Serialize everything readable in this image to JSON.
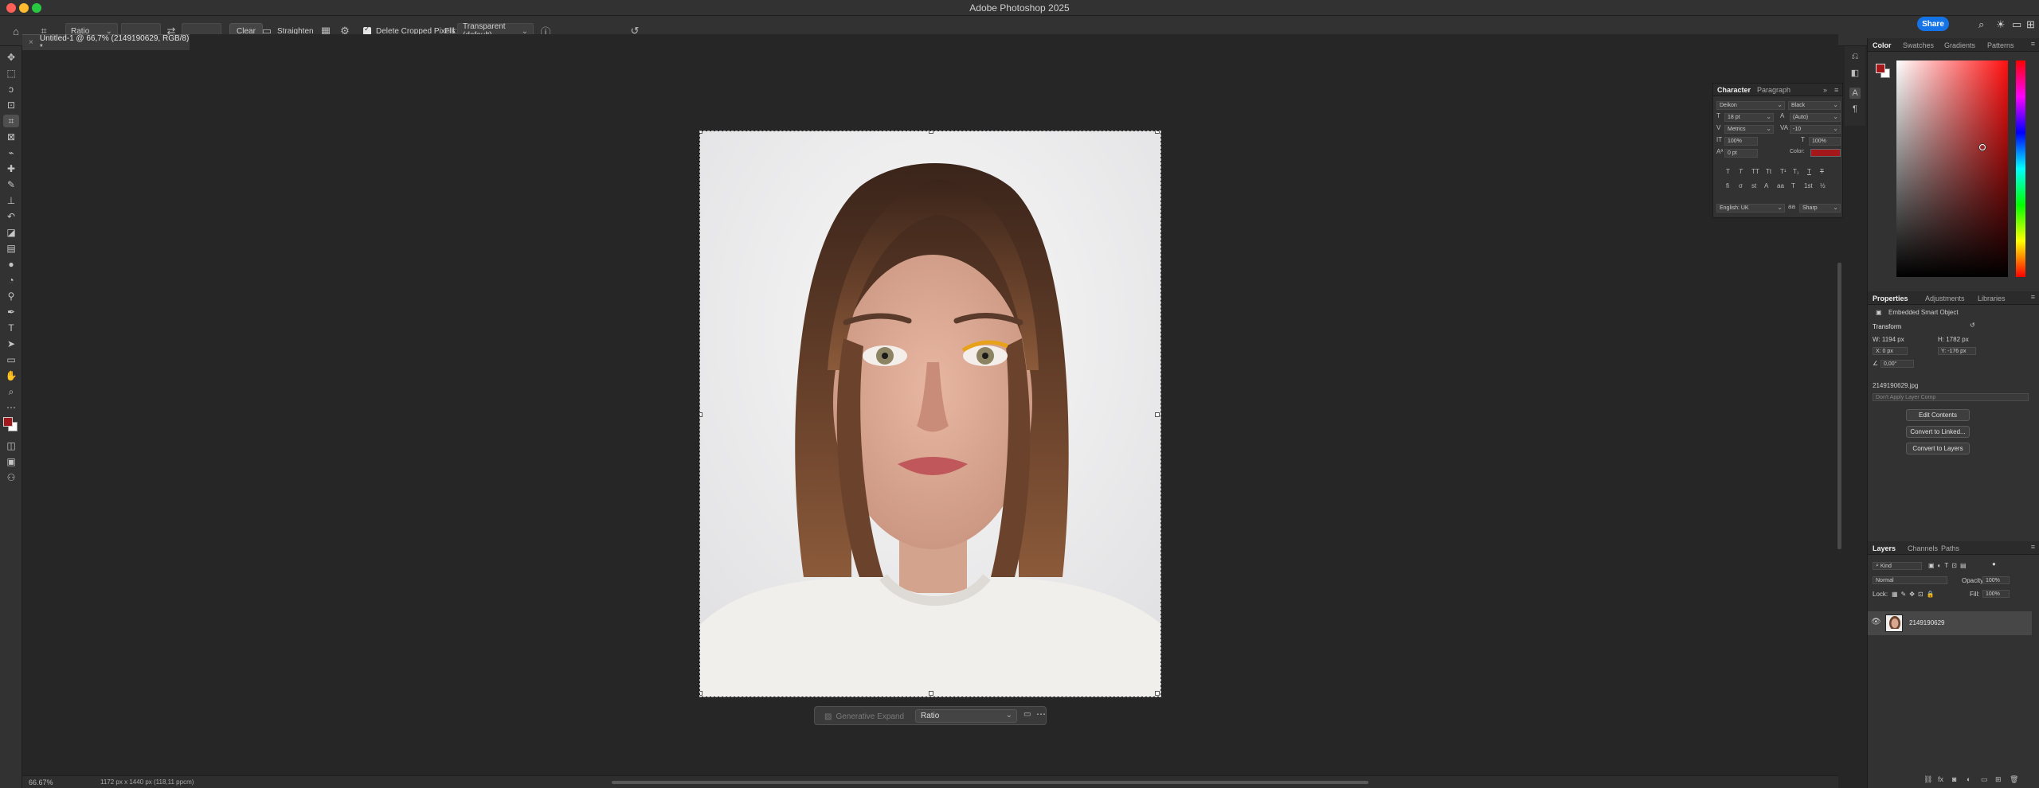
{
  "app": {
    "title": "Adobe Photoshop 2025",
    "share_label": "Share"
  },
  "options_bar": {
    "ratio_label": "Ratio",
    "clear_label": "Clear",
    "straighten_label": "Straighten",
    "delete_cropped_label": "Delete Cropped Pixels",
    "fill_label": "Fill:",
    "fill_value": "Transparent (default)"
  },
  "document": {
    "tab_title": "Untitled-1 @ 66,7% (2149190629, RGB/8) *"
  },
  "generative_bar": {
    "expand_label": "Generative Expand",
    "ratio_value": "Ratio"
  },
  "status": {
    "zoom": "66.67%",
    "doc_info": "1172 px x 1440 px (118,11 ppcm)"
  },
  "character": {
    "tabs": [
      "Character",
      "Paragraph"
    ],
    "font_family": "Deikon",
    "font_style": "Black",
    "font_size": "18 pt",
    "leading": "(Auto)",
    "kerning": "Metrics",
    "tracking": "-10",
    "vertical_scale": "100%",
    "horizontal_scale": "100%",
    "baseline_shift": "0 pt",
    "color_label": "Color:",
    "language": "English: UK",
    "antialias": "Sharp",
    "color_value": "#a4171a"
  },
  "color_panel": {
    "tabs": [
      "Color",
      "Swatches",
      "Gradients",
      "Patterns"
    ],
    "foreground": "#a4171a"
  },
  "properties": {
    "tabs": [
      "Properties",
      "Adjustments",
      "Libraries"
    ],
    "object_type": "Embedded Smart Object",
    "transform_label": "Transform",
    "w": "W: 1194 px",
    "h": "H: 1782 px",
    "x": "X: 0 px",
    "y": "Y: -176 px",
    "angle": "0,00°",
    "file_name": "2149190629.jpg",
    "layer_comp": "Don't Apply Layer Comp",
    "buttons": [
      "Edit Contents",
      "Convert to Linked...",
      "Convert to Layers"
    ]
  },
  "layers": {
    "tabs": [
      "Layers",
      "Channels",
      "Paths"
    ],
    "filter_kind": "Kind",
    "blend_mode": "Normal",
    "opacity_label": "Opacity:",
    "opacity_value": "100%",
    "lock_label": "Lock:",
    "fill_label": "Fill:",
    "fill_value": "100%",
    "layer_name": "2149190629"
  }
}
